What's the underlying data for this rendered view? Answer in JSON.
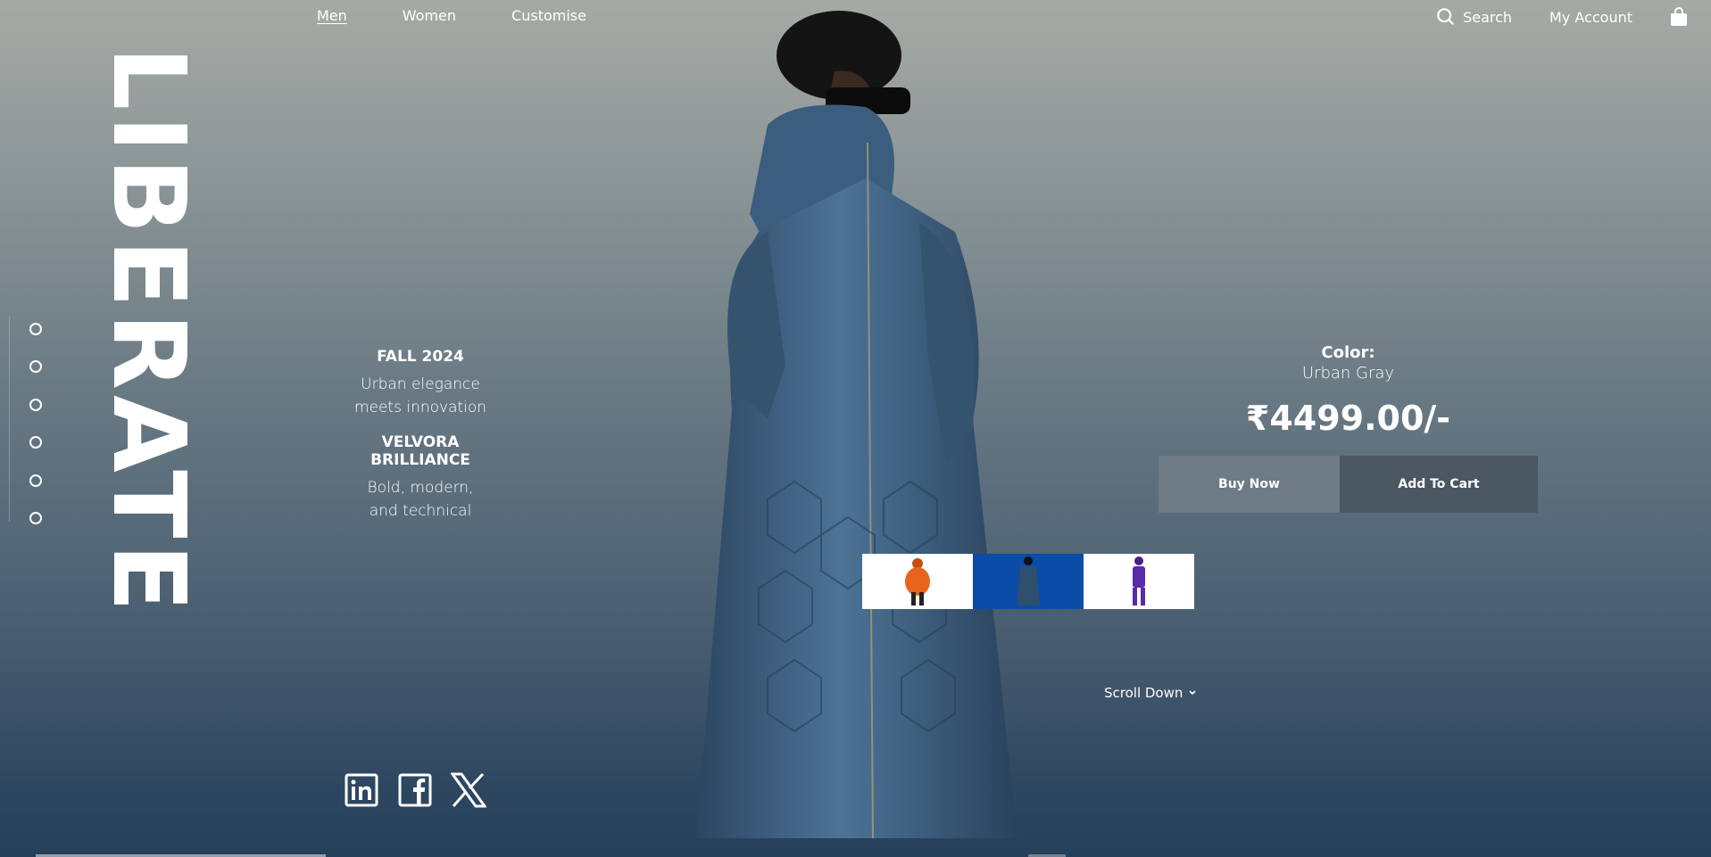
{
  "nav": {
    "left": [
      {
        "label": "Men",
        "active": true
      },
      {
        "label": "Women",
        "active": false
      },
      {
        "label": "Customise",
        "active": false
      }
    ],
    "search_label": "Search",
    "account_label": "My Account",
    "bag_icon": "shopping-bag-icon"
  },
  "brand": "LIBERATE",
  "slide_indicators": 6,
  "tagline": {
    "season": "FALL 2024",
    "season_text_1": "Urban elegance",
    "season_text_2": "meets innovation",
    "collection": "VELVORA BRILLIANCE",
    "collection_text_1": "Bold, modern,",
    "collection_text_2": "and technical"
  },
  "social": [
    "linkedin-icon",
    "facebook-icon",
    "x-icon"
  ],
  "product": {
    "color_label": "Color:",
    "color_value": "Urban Gray",
    "price": "₹4499.00/-",
    "buy_label": "Buy Now",
    "cart_label": "Add To Cart"
  },
  "variants": [
    {
      "name": "orange-puffer",
      "selected": false,
      "color": "#e8641c"
    },
    {
      "name": "blue-quilted-coat",
      "selected": true,
      "color": "#2f4f6f"
    },
    {
      "name": "purple-suit",
      "selected": false,
      "color": "#5b2aa8"
    }
  ],
  "scroll_label": "Scroll Down",
  "colors": {
    "accent_selected": "#0b4ca8",
    "buy_button": "#6c7b85",
    "cart_button": "#4a5662"
  }
}
